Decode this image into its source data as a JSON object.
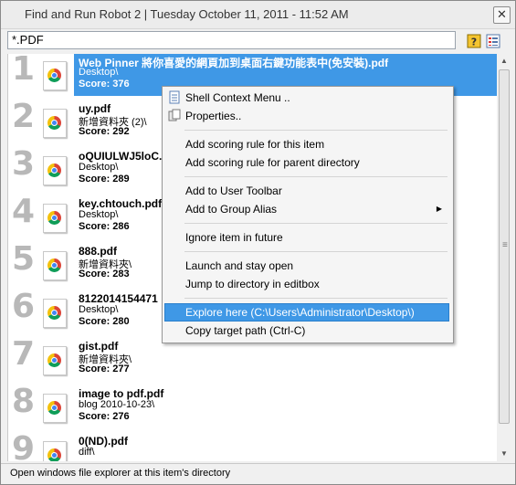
{
  "window": {
    "title": "Find and Run Robot 2 | Tuesday October 11, 2011  -  11:52 AM"
  },
  "search": {
    "value": "*.PDF"
  },
  "toolbar": {
    "help_icon": "help-icon",
    "list_icon": "list-view-icon"
  },
  "results": [
    {
      "num": "1",
      "name": "Web Pinner 將你喜愛的網頁加到桌面右鍵功能表中(免安裝).pdf",
      "dir": "Desktop\\",
      "score": "Score: 376"
    },
    {
      "num": "2",
      "name": "uy.pdf",
      "dir": "新增資料夾 (2)\\",
      "score": "Score: 292"
    },
    {
      "num": "3",
      "name": "oQUIULWJ5loC.",
      "dir": "Desktop\\",
      "score": "Score: 289"
    },
    {
      "num": "4",
      "name": "key.chtouch.pdf",
      "dir": "Desktop\\",
      "score": "Score: 286"
    },
    {
      "num": "5",
      "name": "888.pdf",
      "dir": "新增資料夾\\",
      "score": "Score: 283"
    },
    {
      "num": "6",
      "name": "8122014154471",
      "dir": "Desktop\\",
      "score": "Score: 280"
    },
    {
      "num": "7",
      "name": "gist.pdf",
      "dir": "新增資料夾\\",
      "score": "Score: 277"
    },
    {
      "num": "8",
      "name": "image to pdf.pdf",
      "dir": "blog  2010-10-23\\",
      "score": "Score: 276"
    },
    {
      "num": "9",
      "name": "0(ND).pdf",
      "dir": "diff\\",
      "score": ""
    }
  ],
  "context_menu": {
    "shell": "Shell Context Menu ..",
    "properties": "Properties..",
    "add_scoring_item": "Add scoring rule for this item",
    "add_scoring_parent": "Add scoring rule for parent directory",
    "add_toolbar": "Add to User Toolbar",
    "add_group_alias": "Add to Group Alias",
    "ignore": "Ignore item in future",
    "launch_stay": "Launch and stay open",
    "jump_dir": "Jump to directory in editbox",
    "explore_here": "Explore here (C:\\Users\\Administrator\\Desktop\\)",
    "copy_path": "Copy target path (Ctrl-C)"
  },
  "statusbar": {
    "text": "Open windows file explorer at this item's directory"
  },
  "colors": {
    "selection": "#3f98e6",
    "number_gray": "#b8b8b8"
  }
}
